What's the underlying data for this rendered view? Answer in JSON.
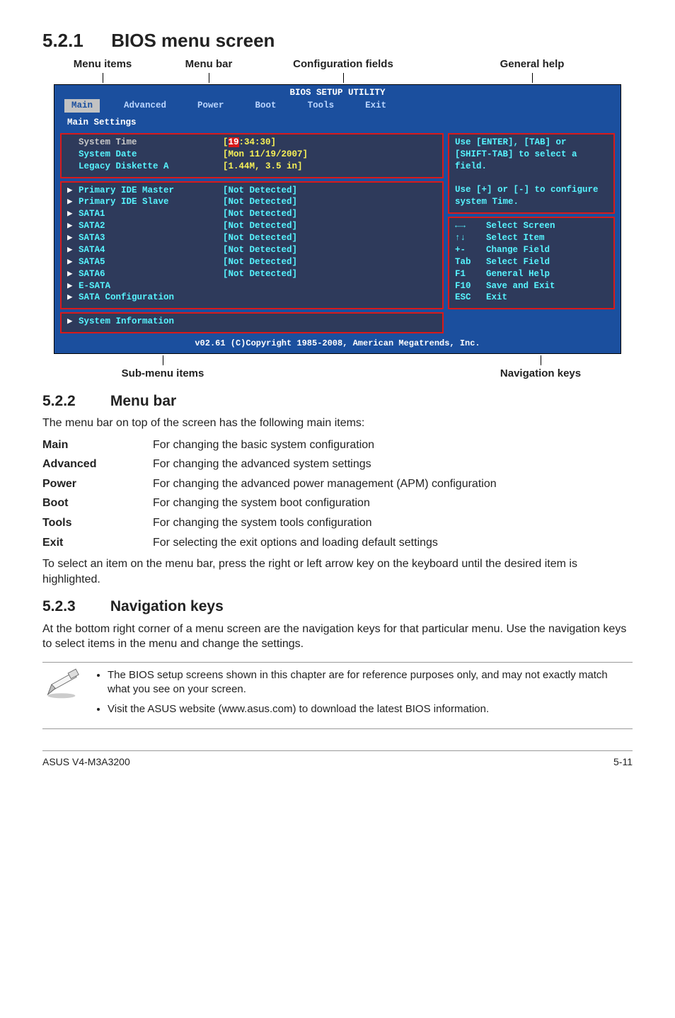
{
  "section_521": {
    "num": "5.2.1",
    "title": "BIOS menu screen"
  },
  "annotations_top": {
    "menu_items": "Menu items",
    "menu_bar": "Menu bar",
    "config_fields": "Configuration fields",
    "general_help": "General help"
  },
  "bios": {
    "title": "BIOS SETUP UTILITY",
    "tabs": [
      "Main",
      "Advanced",
      "Power",
      "Boot",
      "Tools",
      "Exit"
    ],
    "settings_title": "Main Settings",
    "left_top": [
      {
        "label": "System Time",
        "value": "[19:34:30]",
        "hl_val": true,
        "hl_first": true
      },
      {
        "label": "System Date",
        "value": "[Mon 11/19/2007]"
      },
      {
        "label": "Legacy Diskette A",
        "value": "[1.44M, 3.5 in]"
      }
    ],
    "left_mid": [
      {
        "label": "Primary IDE Master",
        "value": "[Not Detected]"
      },
      {
        "label": "Primary IDE Slave",
        "value": "[Not Detected]"
      },
      {
        "label": "SATA1",
        "value": "[Not Detected]"
      },
      {
        "label": "SATA2",
        "value": "[Not Detected]"
      },
      {
        "label": "SATA3",
        "value": "[Not Detected]"
      },
      {
        "label": "SATA4",
        "value": "[Not Detected]"
      },
      {
        "label": "SATA5",
        "value": "[Not Detected]"
      },
      {
        "label": "SATA6",
        "value": "[Not Detected]"
      },
      {
        "label": "E-SATA",
        "value": ""
      },
      {
        "label": "SATA Configuration",
        "value": ""
      }
    ],
    "left_bot": [
      {
        "label": "System Information",
        "value": ""
      }
    ],
    "help_top": "Use [ENTER], [TAB] or [SHIFT-TAB] to select a field.\n\nUse [+] or [-] to configure system Time.",
    "help_keys": [
      {
        "k": "←→",
        "d": "Select Screen"
      },
      {
        "k": "↑↓",
        "d": "Select Item"
      },
      {
        "k": "+-",
        "d": "Change Field"
      },
      {
        "k": "Tab",
        "d": "Select Field"
      },
      {
        "k": "F1",
        "d": "General Help"
      },
      {
        "k": "F10",
        "d": "Save and Exit"
      },
      {
        "k": "ESC",
        "d": "Exit"
      }
    ],
    "copyright": "v02.61 (C)Copyright 1985-2008, American Megatrends, Inc."
  },
  "annotations_bottom": {
    "sub_menu": "Sub-menu items",
    "nav_keys": "Navigation keys"
  },
  "section_522": {
    "num": "5.2.2",
    "title": "Menu bar",
    "intro": "The menu bar on top of the screen has the following main items:",
    "rows": [
      {
        "k": "Main",
        "d": "For changing the basic system configuration"
      },
      {
        "k": "Advanced",
        "d": "For changing the advanced system settings"
      },
      {
        "k": "Power",
        "d": "For changing the advanced power management (APM) configuration"
      },
      {
        "k": "Boot",
        "d": "For changing the system boot configuration"
      },
      {
        "k": "Tools",
        "d": "For changing the system tools configuration"
      },
      {
        "k": "Exit",
        "d": "For selecting the exit options and loading default settings"
      }
    ],
    "outro": "To select an item on the menu bar, press the right or left arrow key on the keyboard until the desired item is highlighted."
  },
  "section_523": {
    "num": "5.2.3",
    "title": "Navigation keys",
    "body": "At the bottom right corner of a menu screen are the navigation keys for that particular menu. Use the navigation keys to select items in the menu and change the settings."
  },
  "notes": [
    "The BIOS setup screens shown in this chapter are for reference purposes only, and may not exactly match what you see on your screen.",
    "Visit the ASUS website (www.asus.com) to download the latest BIOS information."
  ],
  "footer": {
    "left": "ASUS V4-M3A3200",
    "right": "5-11"
  }
}
